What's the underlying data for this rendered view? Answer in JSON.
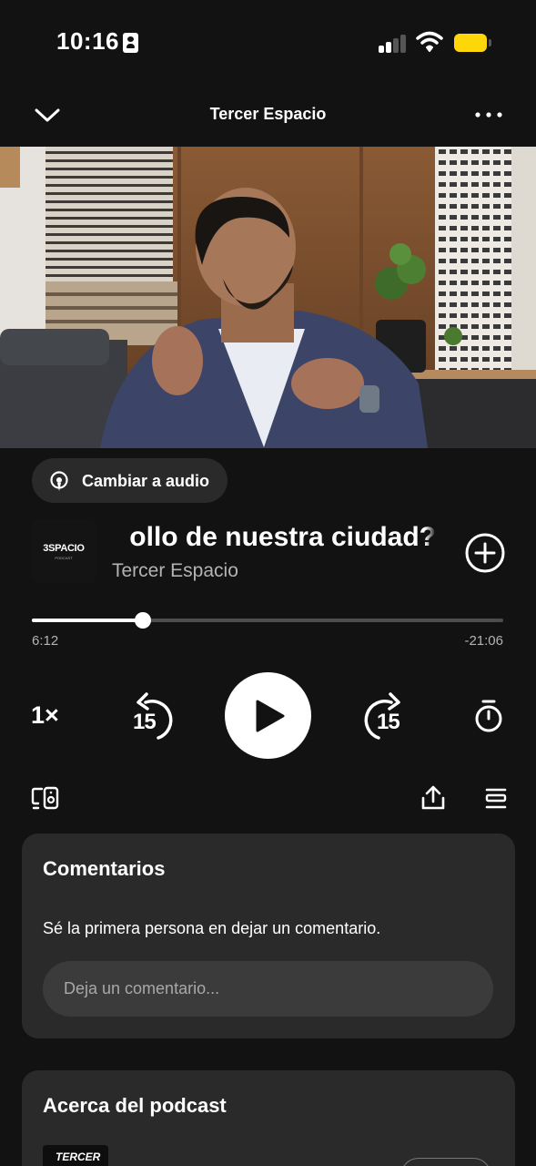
{
  "status_bar": {
    "time": "10:16"
  },
  "nav": {
    "title": "Tercer Espacio"
  },
  "colors": {
    "background": "#121212",
    "card": "#2a2a2a",
    "battery": "#ffd60a",
    "secondary_text": "#b3b3b3"
  },
  "switch_audio": {
    "label": "Cambiar a audio"
  },
  "episode": {
    "artwork_text": "3SPACIO",
    "artwork_subtext": "PODCAST",
    "title_visible": "ollo de nuestra ciudad?",
    "show_name": "Tercer Espacio"
  },
  "progress": {
    "elapsed": "6:12",
    "remaining": "-21:06",
    "fraction": 0.235
  },
  "controls": {
    "speed": "1×",
    "skip_back_seconds": "15",
    "skip_forward_seconds": "15"
  },
  "icons": [
    "chevron-down-icon",
    "more-icon",
    "audio-podcast-icon",
    "add-circle-icon",
    "skip-back-icon",
    "play-icon",
    "skip-forward-icon",
    "sleep-timer-icon",
    "connect-device-icon",
    "share-icon",
    "queue-icon"
  ],
  "comments": {
    "title": "Comentarios",
    "empty_message": "Sé la primera persona en dejar un comentario.",
    "input_placeholder": "Deja un comentario..."
  },
  "about": {
    "title": "Acerca del podcast",
    "artwork_text": "TERCER"
  }
}
